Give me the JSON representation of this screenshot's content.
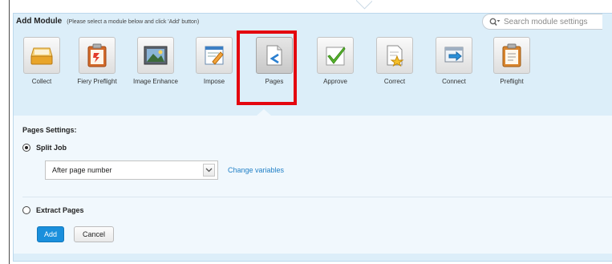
{
  "header": {
    "title": "Add Module",
    "hint": "(Please select a module below and click 'Add' button)"
  },
  "search": {
    "placeholder": "Search module settings",
    "icon": "search-dropdown-icon"
  },
  "modules": [
    {
      "label": "Collect",
      "icon": "collect-icon"
    },
    {
      "label": "Fiery Preflight",
      "icon": "fiery-preflight-icon"
    },
    {
      "label": "Image Enhance",
      "icon": "image-enhance-icon"
    },
    {
      "label": "Impose",
      "icon": "impose-icon"
    },
    {
      "label": "Pages",
      "icon": "pages-icon",
      "selected": true
    },
    {
      "label": "Approve",
      "icon": "approve-icon"
    },
    {
      "label": "Correct",
      "icon": "correct-icon"
    },
    {
      "label": "Connect",
      "icon": "connect-icon"
    },
    {
      "label": "Preflight",
      "icon": "preflight-icon"
    }
  ],
  "settings": {
    "title": "Pages Settings:",
    "split_job": {
      "label": "Split Job",
      "selected": true
    },
    "split_option": {
      "value": "After page number"
    },
    "change_variables": "Change variables",
    "extract_pages": {
      "label": "Extract Pages",
      "selected": false
    }
  },
  "buttons": {
    "add": "Add",
    "cancel": "Cancel"
  },
  "colors": {
    "panel_bg": "#dceef9",
    "settings_bg": "#f1f8fd",
    "accent": "#1a8fdc",
    "link": "#1f7fc6",
    "highlight": "#e4060f"
  }
}
